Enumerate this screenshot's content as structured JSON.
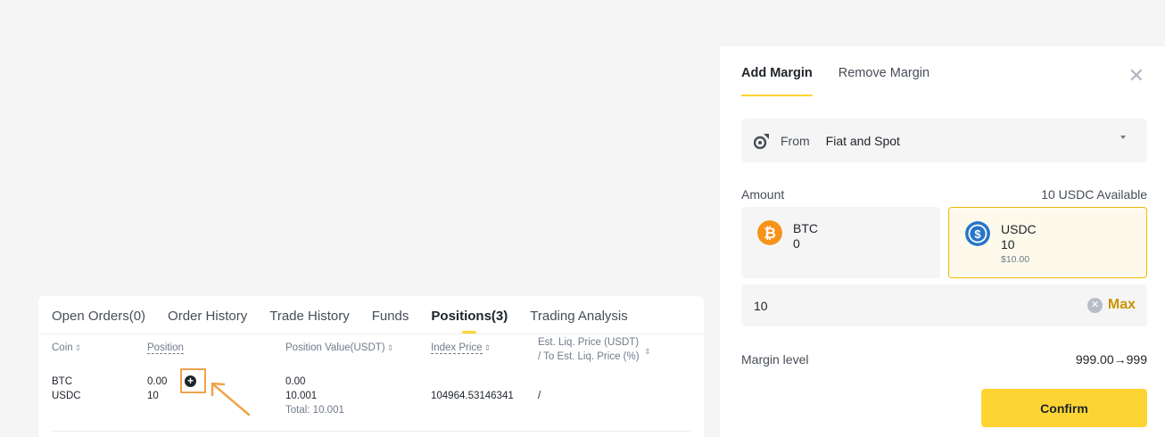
{
  "positions": {
    "tabs": [
      {
        "label": "Open Orders(0)"
      },
      {
        "label": "Order History"
      },
      {
        "label": "Trade History"
      },
      {
        "label": "Funds"
      },
      {
        "label": "Positions(3)"
      },
      {
        "label": "Trading Analysis"
      }
    ],
    "headers": {
      "coin": "Coin",
      "position": "Position",
      "position_value": "Position Value(USDT)",
      "index_price": "Index Price",
      "est_liq_line1": "Est. Liq. Price (USDT)",
      "est_liq_line2": "/ To Est. Liq. Price (%)"
    },
    "rows": [
      {
        "coin": "BTC",
        "position": "0.00",
        "position_value": "0.00",
        "index_price": "",
        "est_liq": ""
      },
      {
        "coin": "USDC",
        "position": "10",
        "position_value": "10.001",
        "index_price": "104964.53146341",
        "est_liq": "/"
      }
    ],
    "total": "Total: 10.001",
    "sort_glyph": "⇕"
  },
  "modal": {
    "tabs": [
      {
        "label": "Add Margin"
      },
      {
        "label": "Remove Margin"
      }
    ],
    "close_glyph": "✕",
    "from_label": "From",
    "from_value": "Fiat and Spot",
    "amount_label": "Amount",
    "available": "10 USDC Available",
    "coins": [
      {
        "name": "BTC",
        "amount": "0",
        "usd": ""
      },
      {
        "name": "USDC",
        "amount": "10",
        "usd": "$10.00"
      }
    ],
    "amount_value": "10",
    "max_label": "Max",
    "margin_level_label": "Margin level",
    "margin_level_value": "999.00→999",
    "confirm_label": "Confirm"
  },
  "colors": {
    "accent": "#fcd535",
    "highlight_box": "#f0a24b",
    "btc": "#f7931a",
    "usdc": "#2775ca"
  },
  "icons": [
    "plus-circle-icon",
    "arrow-pointer-icon",
    "close-icon",
    "wallet-transfer-icon",
    "chevron-down-icon",
    "btc-icon",
    "usdc-icon",
    "clear-icon",
    "sort-icon"
  ]
}
